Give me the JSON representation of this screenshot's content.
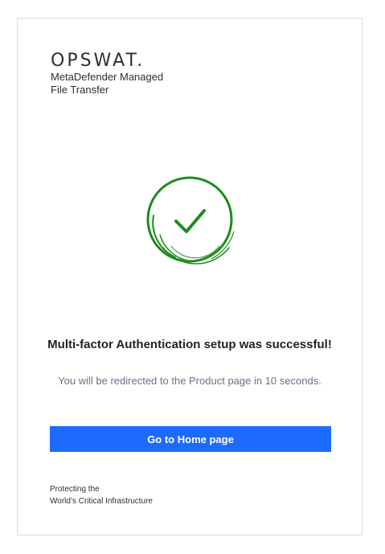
{
  "brand": {
    "logo_text": "OPSWAT.",
    "product_line1": "MetaDefender Managed",
    "product_line2": "File Transfer"
  },
  "status": {
    "icon": "success-check-icon",
    "color": "#1e8b1e",
    "title": "Multi-factor Authentication setup was successful!",
    "message": "You will be redirected to the Product page in 10 seconds."
  },
  "actions": {
    "home_button_label": "Go to Home page",
    "home_button_color": "#1d6bfc"
  },
  "footer": {
    "line1": "Protecting the",
    "line2": "World’s Critical Infrastructure"
  }
}
